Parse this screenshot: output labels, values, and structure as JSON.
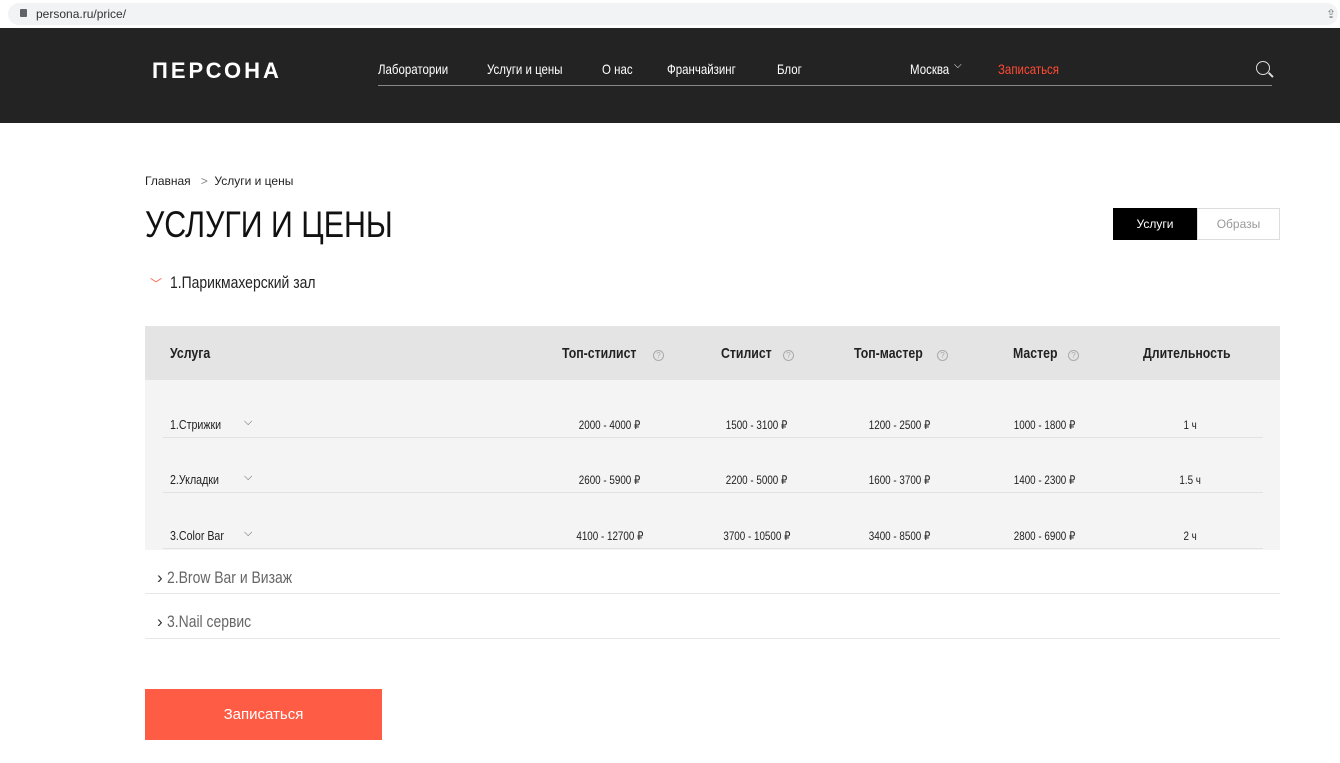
{
  "browser": {
    "url": "persona.ru/price/"
  },
  "header": {
    "logo": "ПЕРСОНА",
    "nav": [
      "Лаборатории",
      "Услуги и цены",
      "О нас",
      "Франчайзинг",
      "Блог"
    ],
    "city": "Москва",
    "book": "Записаться"
  },
  "breadcrumb": {
    "home": "Главная",
    "sep": ">",
    "current": "Услуги и цены"
  },
  "page_title": "УСЛУГИ И ЦЕНЫ",
  "tabs": {
    "services": "Услуги",
    "looks": "Образы"
  },
  "sections": [
    {
      "title": "1.Парикмахерский зал",
      "expanded": true
    },
    {
      "title": "2.Brow Bar и Визаж"
    },
    {
      "title": "3.Nail сервис"
    }
  ],
  "table": {
    "headers": [
      "Услуга",
      "Топ-стилист",
      "Стилист",
      "Топ-мастер",
      "Мастер",
      "Длительность"
    ],
    "help": "?",
    "rows": [
      {
        "name": "1.Стрижки",
        "cells": [
          "2000 - 4000 ₽",
          "1500 - 3100 ₽",
          "1200 - 2500 ₽",
          "1000 - 1800 ₽",
          "1 ч"
        ]
      },
      {
        "name": "2.Укладки",
        "cells": [
          "2600 - 5900 ₽",
          "2200 - 5000 ₽",
          "1600 - 3700 ₽",
          "1400 - 2300 ₽",
          "1.5 ч"
        ]
      },
      {
        "name": "3.Color Bar",
        "cells": [
          "4100 - 12700 ₽",
          "3700 - 10500 ₽",
          "3400 - 8500 ₽",
          "2800 - 6900 ₽",
          "2 ч"
        ]
      }
    ]
  },
  "cta": "Записаться",
  "colors": {
    "accent": "#ff5c45",
    "header_bg": "#232323"
  }
}
